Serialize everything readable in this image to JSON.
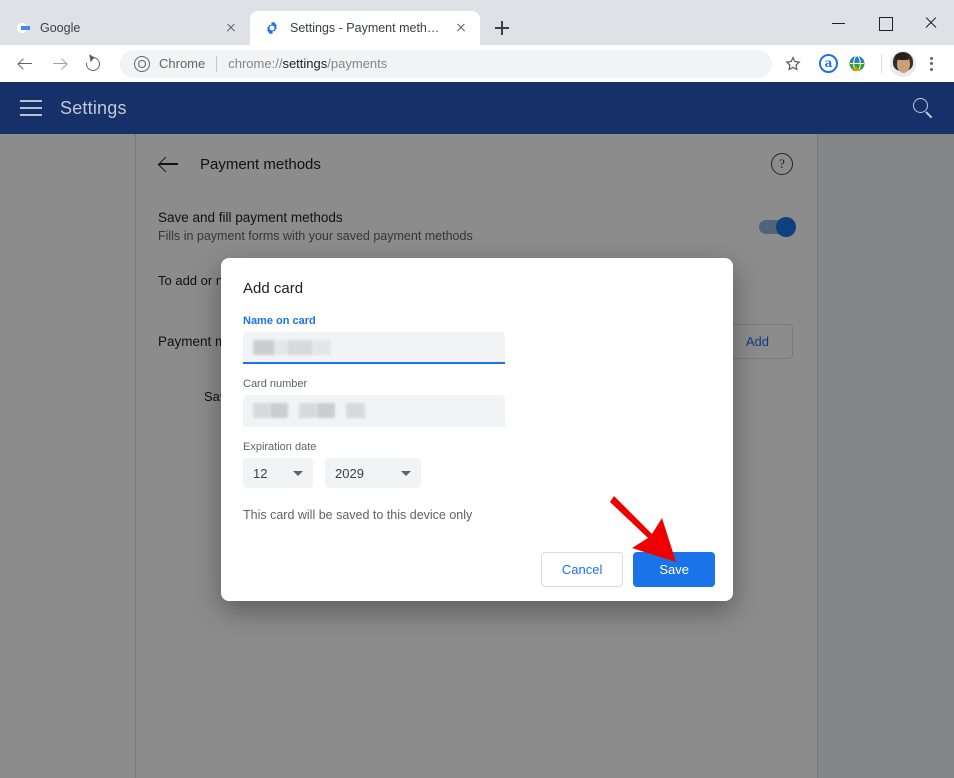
{
  "window": {
    "controls": {
      "minimize": "minimize-button",
      "maximize": "maximize-button",
      "close": "close-button"
    }
  },
  "tabs": [
    {
      "title": "Google",
      "favicon": "google-favicon",
      "active": false
    },
    {
      "title": "Settings - Payment methods",
      "favicon": "gear-favicon",
      "active": true
    }
  ],
  "newtab_label": "+",
  "toolbar": {
    "back": "back-icon",
    "forward": "forward-icon",
    "reload": "reload-icon",
    "omnibox": {
      "badge_label": "Chrome",
      "url_prefix": "chrome://",
      "url_strong": "settings",
      "url_suffix": "/payments",
      "full_url": "chrome://settings/payments"
    },
    "bookmark": "star-icon",
    "extension_a": "a",
    "extension_globe": "globe-extension-icon",
    "profile": "avatar",
    "menu": "kebab-menu-icon"
  },
  "settings_header": {
    "menu_icon": "hamburger-icon",
    "title": "Settings",
    "search_icon": "search-icon"
  },
  "page": {
    "back_icon": "back-arrow-icon",
    "title": "Payment methods",
    "help_icon": "help-icon",
    "save_and_fill": {
      "title": "Save and fill payment methods",
      "subtitle": "Fills in payment forms with your saved payment methods",
      "toggle_on": true
    },
    "note": "To add or n",
    "payment_methods_label": "Payment m",
    "add_button": "Add",
    "saved_label": "Save"
  },
  "dialog": {
    "title": "Add card",
    "fields": [
      {
        "label": "Name on card",
        "focused": true,
        "value": "",
        "redacted": true
      },
      {
        "label": "Card number",
        "focused": false,
        "value": "",
        "redacted": true
      }
    ],
    "expiration": {
      "label": "Expiration date",
      "month": "12",
      "year": "2029"
    },
    "note": "This card will be saved to this device only",
    "cancel_label": "Cancel",
    "save_label": "Save"
  },
  "annotation": {
    "arrow": "red-arrow-pointing-to-save"
  },
  "colors": {
    "accent_blue": "#1a73e8",
    "settings_header": "#16306a",
    "arrow_red": "#ee0000",
    "tabstrip": "#dee1e6"
  }
}
